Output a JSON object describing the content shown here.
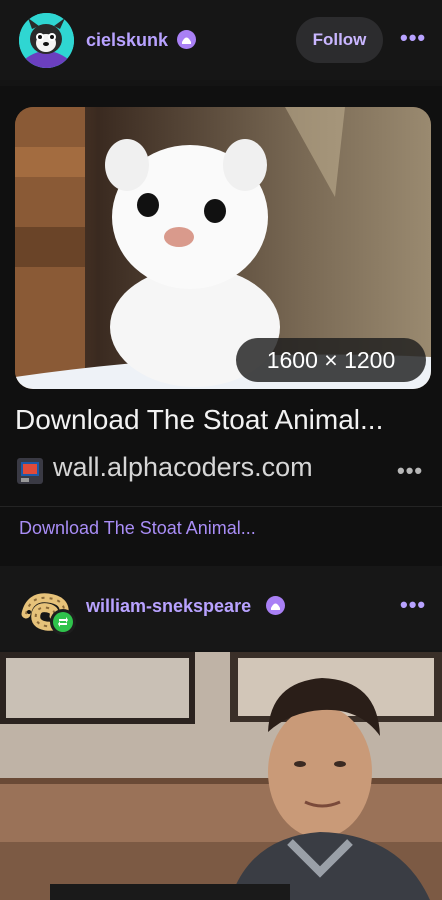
{
  "post1": {
    "username": "cielskunk",
    "follow_label": "Follow",
    "more_label": "•••",
    "image": {
      "dimensions": "1600 × 1200"
    },
    "link": {
      "title": "Download The Stoat Animal...",
      "domain": "wall.alphacoders.com",
      "more_label": "•••"
    },
    "caption": "Download The Stoat Animal..."
  },
  "post2": {
    "username": "william-snekspeare",
    "more_label": "•••"
  },
  "colors": {
    "accent": "#b8a2ff",
    "background": "#141414",
    "reblog_green": "#2fc34c"
  },
  "icons": {
    "badge": "community-badge-icon",
    "reblog": "reblog-icon",
    "more": "more-dots-icon"
  }
}
